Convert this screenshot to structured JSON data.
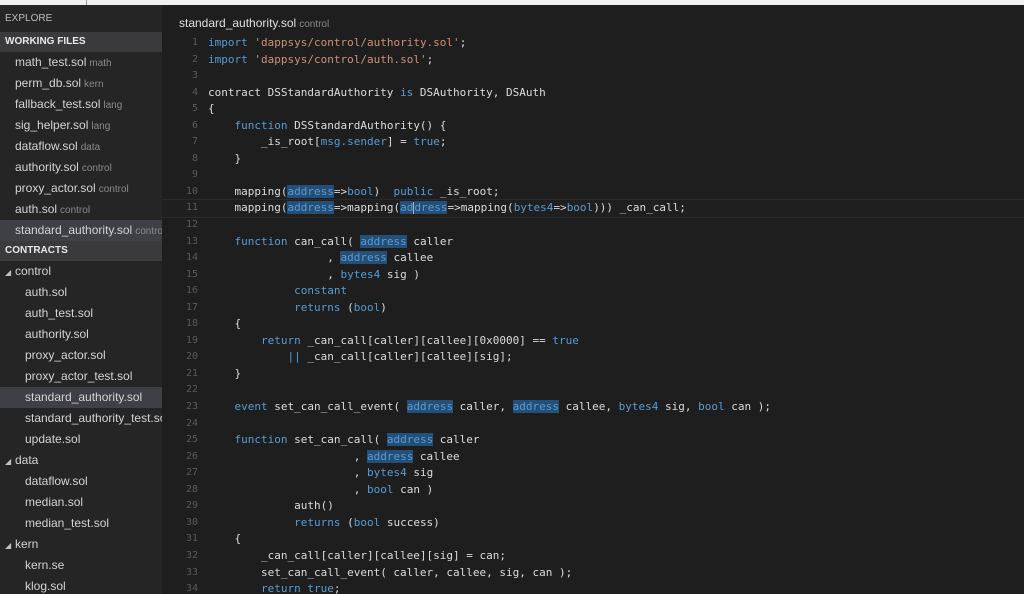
{
  "sidebar": {
    "explore_label": "EXPLORE",
    "working_files_header": "WORKING FILES",
    "working_files": [
      {
        "name": "math_test.sol",
        "folder": "math"
      },
      {
        "name": "perm_db.sol",
        "folder": "kern"
      },
      {
        "name": "fallback_test.sol",
        "folder": "lang"
      },
      {
        "name": "sig_helper.sol",
        "folder": "lang"
      },
      {
        "name": "dataflow.sol",
        "folder": "data"
      },
      {
        "name": "authority.sol",
        "folder": "control"
      },
      {
        "name": "proxy_actor.sol",
        "folder": "control"
      },
      {
        "name": "auth.sol",
        "folder": "control"
      },
      {
        "name": "standard_authority.sol",
        "folder": "control"
      }
    ],
    "contracts_header": "CONTRACTS",
    "folders": [
      {
        "name": "control",
        "files": [
          "auth.sol",
          "auth_test.sol",
          "authority.sol",
          "proxy_actor.sol",
          "proxy_actor_test.sol",
          "standard_authority.sol",
          "standard_authority_test.sol",
          "update.sol"
        ]
      },
      {
        "name": "data",
        "files": [
          "dataflow.sol",
          "median.sol",
          "median_test.sol"
        ]
      },
      {
        "name": "kern",
        "files": [
          "kern.se",
          "klog.sol"
        ]
      }
    ]
  },
  "editor": {
    "file_name": "standard_authority.sol",
    "file_folder": "control",
    "line_numbers": [
      "1",
      "2",
      "3",
      "4",
      "5",
      "6",
      "7",
      "8",
      "9",
      "10",
      "11",
      "12",
      "13",
      "14",
      "15",
      "16",
      "17",
      "18",
      "19",
      "20",
      "21",
      "22",
      "23",
      "24",
      "25",
      "26",
      "27",
      "28",
      "29",
      "30",
      "31",
      "32",
      "33",
      "34"
    ],
    "lines": {
      "l1_import": "import",
      "l1_path": "'dappsys/control/authority.sol'",
      "l1_end": ";",
      "l2_import": "import",
      "l2_path": "'dappsys/control/auth.sol'",
      "l2_end": ";",
      "l4_a": "contract DSStandardAuthority ",
      "l4_is": "is",
      "l4_b": " DSAuthority, DSAuth",
      "l5": "{",
      "l6_fn": "function",
      "l6_rest": " DSStandardAuthority() {",
      "l7_a": "_is_root[",
      "l7_msg": "msg.sender",
      "l7_b": "] = ",
      "l7_true": "true",
      "l7_c": ";",
      "l8": "}",
      "l10_mapping": "mapping(",
      "l10_address": "address",
      "l10_arrow": "=>",
      "l10_bool": "bool",
      "l10_close": ")  ",
      "l10_public": "public",
      "l10_rest": " _is_root;",
      "l11_mapping": "mapping(",
      "l11_address1": "address",
      "l11_arrow1": "=>mapping(",
      "l11_addr2_a": "ad",
      "l11_addr2_b": "dress",
      "l11_arrow2": "=>mapping(",
      "l11_bytes4": "bytes4",
      "l11_arrow3": "=>",
      "l11_bool": "bool",
      "l11_rest": "))) _can_call;",
      "l13_fn": "function",
      "l13_a": " can_call( ",
      "l13_address": "address",
      "l13_b": " caller",
      "l14_a": ", ",
      "l14_address": "address",
      "l14_b": " callee",
      "l15_a": ", ",
      "l15_bytes4": "bytes4",
      "l15_b": " sig )",
      "l16_constant": "constant",
      "l17_returns": "returns",
      "l17_a": " (",
      "l17_bool": "bool",
      "l17_b": ")",
      "l18": "{",
      "l19_return": "return",
      "l19_a": " _can_call[caller][callee][0x0000] == ",
      "l19_true": "true",
      "l20_or": "||",
      "l20_a": " _can_call[caller][callee][sig];",
      "l21": "}",
      "l23_event": "event",
      "l23_a": " set_can_call_event( ",
      "l23_address1": "address",
      "l23_b": " caller, ",
      "l23_address2": "address",
      "l23_c": " callee, ",
      "l23_bytes4": "bytes4",
      "l23_d": " sig, ",
      "l23_bool": "bool",
      "l23_e": " can );",
      "l25_fn": "function",
      "l25_a": " set_can_call( ",
      "l25_address": "address",
      "l25_b": " caller",
      "l26_a": ", ",
      "l26_address": "address",
      "l26_b": " callee",
      "l27_a": ", ",
      "l27_bytes4": "bytes4",
      "l27_b": " sig",
      "l28_a": ", ",
      "l28_bool": "bool",
      "l28_b": " can )",
      "l29": "auth()",
      "l30_returns": "returns",
      "l30_a": " (",
      "l30_bool": "bool",
      "l30_b": " success)",
      "l31": "{",
      "l32": "_can_call[caller][callee][sig] = can;",
      "l33": "set_can_call_event( caller, callee, sig, can );",
      "l34_return": "return",
      "l34_true": "true",
      "l34_end": ";"
    }
  },
  "colors": {
    "keyword": "#569cd6",
    "string": "#ce9178",
    "selection_highlight": "#264f78",
    "sidebar_bg": "#252526",
    "editor_bg": "#1e1e1e"
  }
}
